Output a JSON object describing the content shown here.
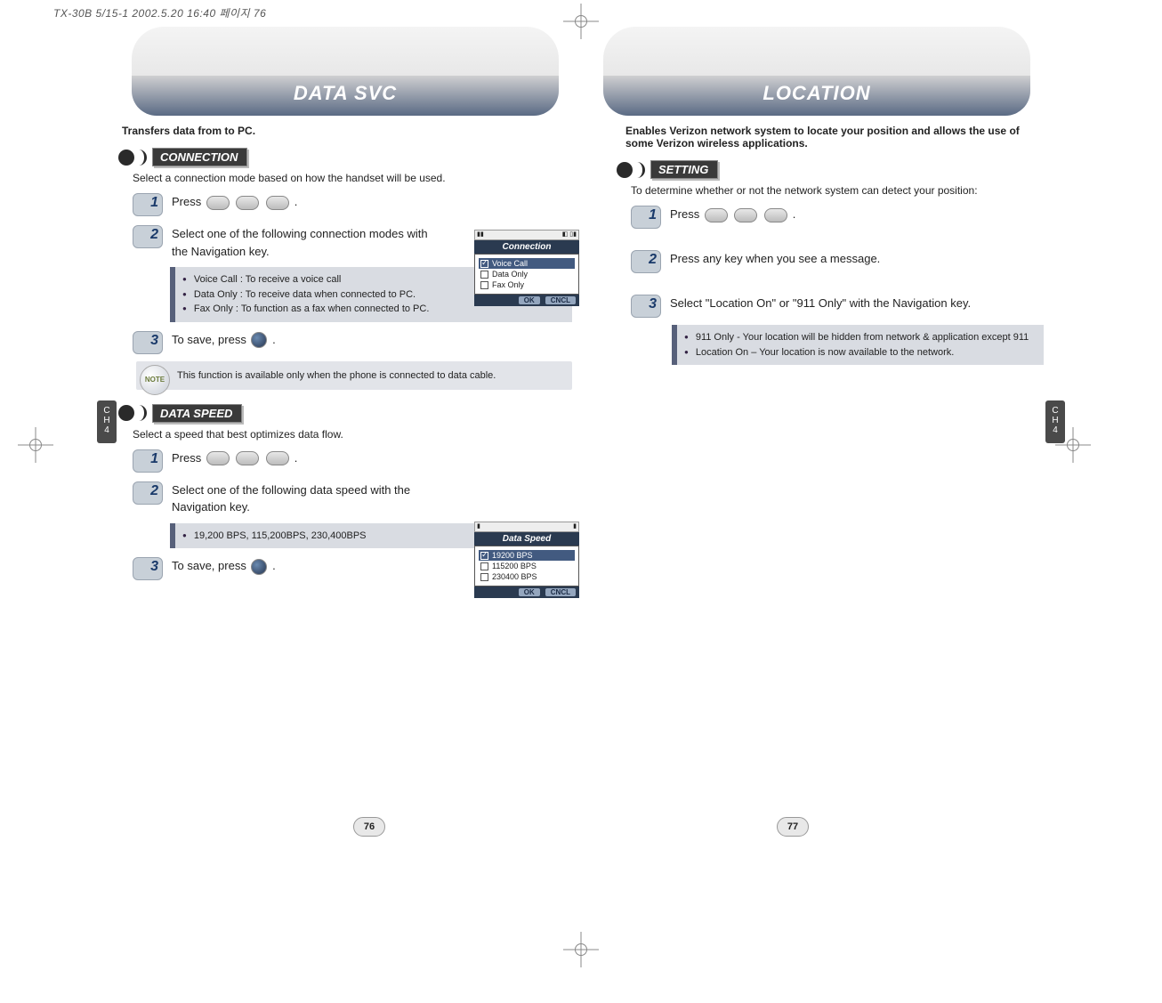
{
  "meta": {
    "header": "TX-30B 5/15-1  2002.5.20 16:40 페이지 76"
  },
  "side_tab": {
    "line1": "C",
    "line2": "H",
    "num": "4"
  },
  "left": {
    "title": "DATA SVC",
    "intro": "Transfers data from to PC.",
    "section_connection": {
      "label": "CONNECTION",
      "desc": "Select a connection mode based on how the handset will be used.",
      "step1": "Press",
      "step2": "Select one of the following connection modes with the Navigation  key.",
      "bullets": [
        "Voice Call : To receive a voice call",
        "Data Only : To receive data when connected to PC.",
        "Fax Only : To function as a fax when connected to PC."
      ],
      "step3": "To save, press",
      "note": "This function is available only when the phone is connected to data cable."
    },
    "section_dataspeed": {
      "label": "DATA SPEED",
      "desc": "Select a speed that best optimizes data flow.",
      "step1": "Press",
      "step2": "Select one of the following data speed with the Navigation  key.",
      "bullets": [
        "19,200 BPS,     115,200BPS,     230,400BPS"
      ],
      "step3": "To save, press"
    },
    "screen_connection": {
      "title": "Connection",
      "items": [
        {
          "label": "Voice Call",
          "selected": true
        },
        {
          "label": "Data Only",
          "selected": false
        },
        {
          "label": "Fax Only",
          "selected": false
        }
      ],
      "ok": "OK",
      "cncl": "CNCL"
    },
    "screen_dataspeed": {
      "title": "Data Speed",
      "items": [
        {
          "label": "19200 BPS",
          "selected": true
        },
        {
          "label": "115200 BPS",
          "selected": false
        },
        {
          "label": "230400 BPS",
          "selected": false
        }
      ],
      "ok": "OK",
      "cncl": "CNCL"
    },
    "page_num": "76"
  },
  "right": {
    "title": "LOCATION",
    "intro": "Enables Verizon network system to locate your position and allows the use of some Verizon wireless applications.",
    "section_setting": {
      "label": "SETTING",
      "desc": "To determine whether or not the network system can detect your position:",
      "step1": "Press",
      "step2": "Press any key when you see a message.",
      "step3": "Select \"Location On\" or \"911 Only\" with the Navigation key.",
      "bullets": [
        "911 Only - Your location will be hidden from network & application except 911",
        "Location On – Your location is now available to the network."
      ]
    },
    "page_num": "77"
  },
  "note_icon_label": "NOTE"
}
